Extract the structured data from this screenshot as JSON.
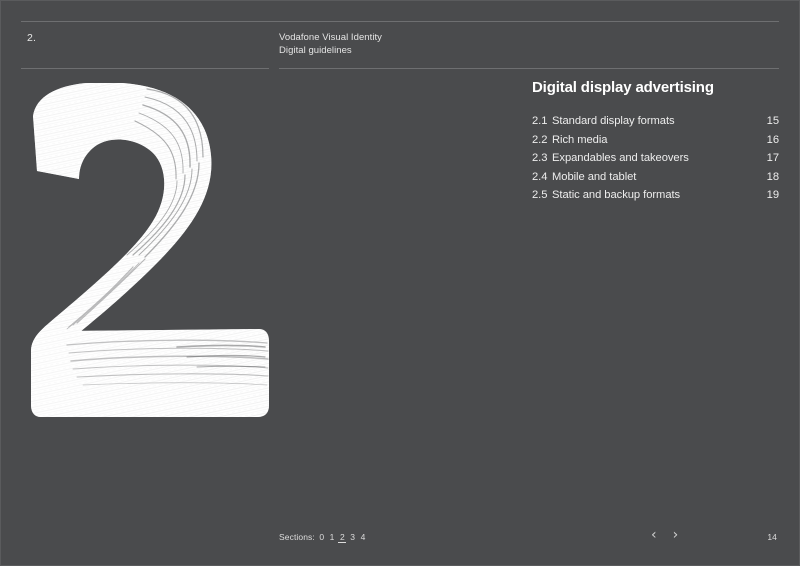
{
  "theme": {
    "background": "#4a4b4d",
    "text": "#ededed",
    "rule": "#6e6f71",
    "artwork_ink": "#ffffff"
  },
  "header": {
    "section_number": "2.",
    "doc_title": "Vodafone Visual Identity",
    "doc_subtitle": "Digital guidelines"
  },
  "artwork": {
    "glyph": "2",
    "description": "brushstroke-numeral-two"
  },
  "main": {
    "title": "Digital display advertising",
    "toc": [
      {
        "num": "2.1",
        "label": "Standard display formats",
        "page": "15"
      },
      {
        "num": "2.2",
        "label": "Rich media",
        "page": "16"
      },
      {
        "num": "2.3",
        "label": "Expandables and takeovers",
        "page": "17"
      },
      {
        "num": "2.4",
        "label": "Mobile and tablet",
        "page": "18"
      },
      {
        "num": "2.5",
        "label": "Static and backup formats",
        "page": "19"
      }
    ]
  },
  "footer": {
    "sections_label": "Sections:",
    "sections": [
      "0",
      "1",
      "2",
      "3",
      "4"
    ],
    "active_section": "2",
    "prev_icon": "‹",
    "next_icon": "›",
    "page_number": "14"
  }
}
